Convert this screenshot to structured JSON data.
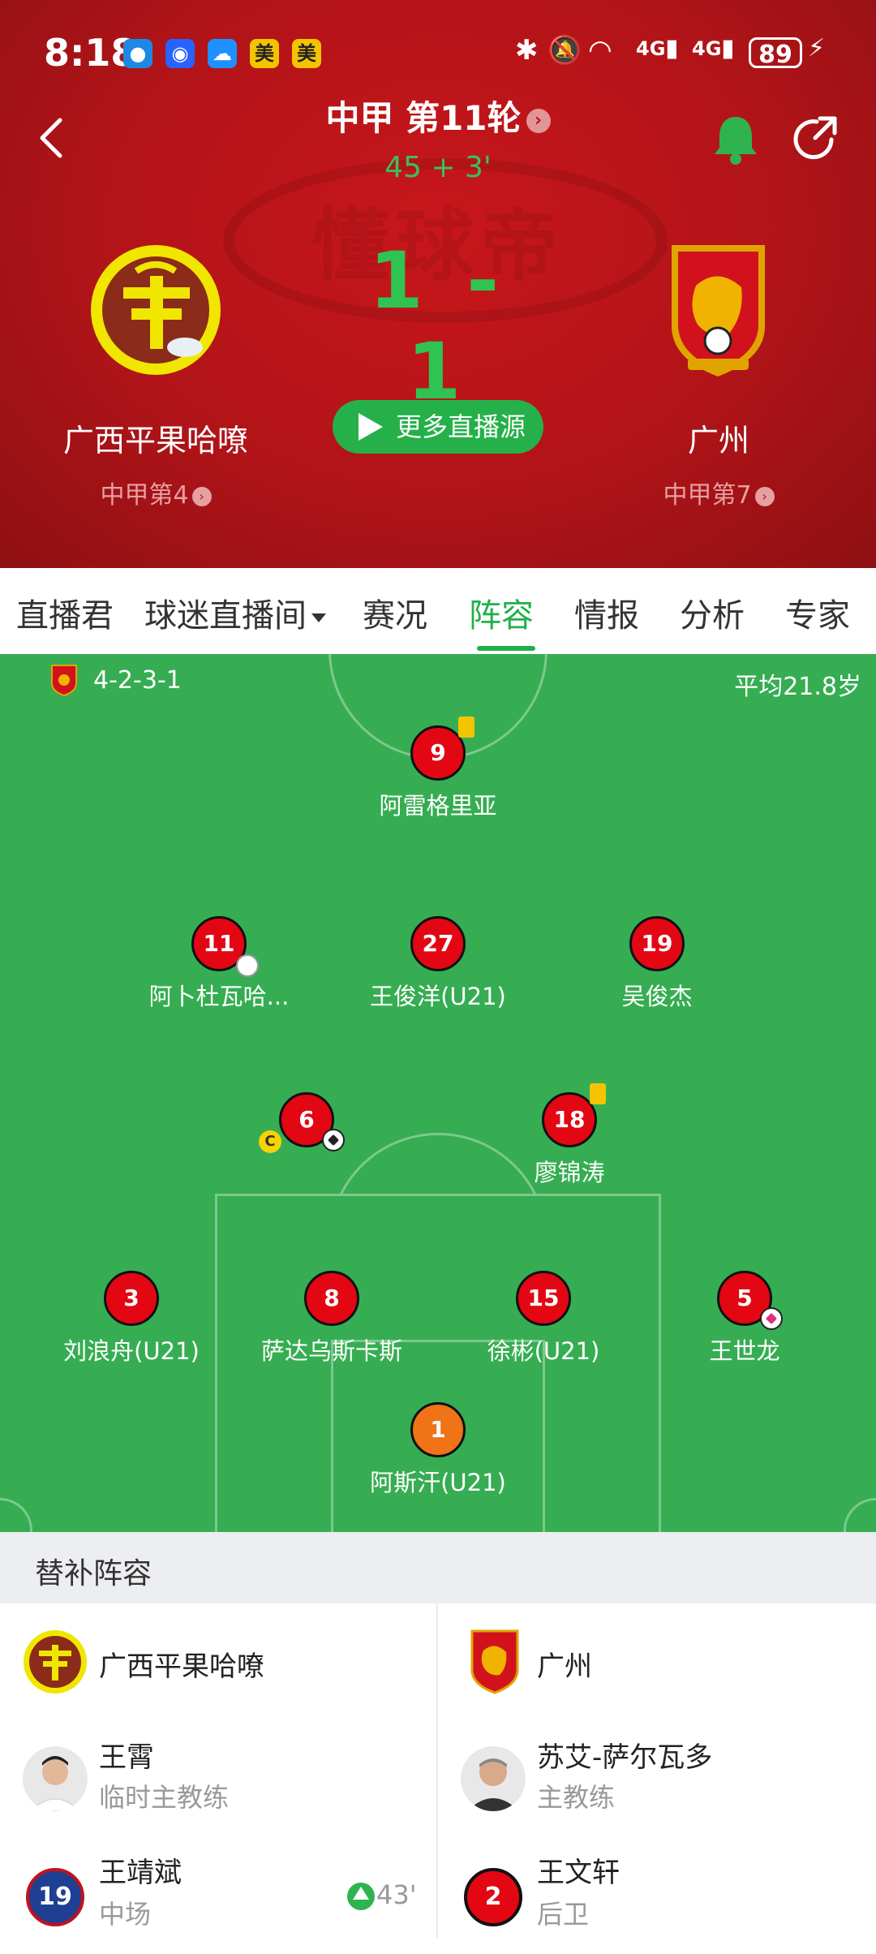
{
  "status": {
    "time": "8:18",
    "apps": [
      "美",
      "美"
    ],
    "network1": "4G",
    "network2": "4G",
    "battery": "89"
  },
  "match": {
    "title": "中甲 第11轮",
    "time": "45 + 3'",
    "score": "1 - 1",
    "more_sources": "更多直播源",
    "home": {
      "name": "广西平果哈嘹",
      "rank": "中甲第4"
    },
    "away": {
      "name": "广州",
      "rank": "中甲第7"
    },
    "watermark": "懂球帝"
  },
  "tabs": [
    {
      "label": "直播君"
    },
    {
      "label": "球迷直播间"
    },
    {
      "label": "赛况"
    },
    {
      "label": "阵容",
      "active": true
    },
    {
      "label": "情报"
    },
    {
      "label": "分析"
    },
    {
      "label": "专家"
    }
  ],
  "lineup": {
    "formation": "4-2-3-1",
    "avg_age": "平均21.8岁",
    "players": [
      {
        "number": "9",
        "name": "阿雷格里亚",
        "yellow": true
      },
      {
        "number": "11",
        "name": "阿卜杜瓦哈...",
        "sub": true
      },
      {
        "number": "27",
        "name": "王俊洋(U21)"
      },
      {
        "number": "19",
        "name": "吴俊杰"
      },
      {
        "number": "6",
        "name": "",
        "captain": true,
        "goal": true
      },
      {
        "number": "18",
        "name": "廖锦涛",
        "yellow": true
      },
      {
        "number": "3",
        "name": "刘浪舟(U21)"
      },
      {
        "number": "8",
        "name": "萨达乌斯卡斯"
      },
      {
        "number": "15",
        "name": "徐彬(U21)"
      },
      {
        "number": "5",
        "name": "王世龙",
        "own_goal": true
      },
      {
        "number": "1",
        "name": "阿斯汗(U21)",
        "gk": true
      }
    ]
  },
  "subs": {
    "title": "替补阵容",
    "home_team": "广西平果哈嘹",
    "away_team": "广州",
    "home_coach": {
      "name": "王霄",
      "role": "临时主教练"
    },
    "away_coach": {
      "name": "苏艾-萨尔瓦多",
      "role": "主教练"
    },
    "home_sub": {
      "number": "19",
      "name": "王靖斌",
      "position": "中场",
      "minute": "43'"
    },
    "away_sub": {
      "number": "2",
      "name": "王文轩",
      "position": "后卫"
    }
  },
  "colors": {
    "header_red": "#b11418",
    "accent_green": "#21b04b",
    "pitch_green": "#36ad52",
    "shirt_red": "#e30613",
    "gk_orange": "#f07317",
    "home_sub_blue": "#1f3f93"
  }
}
